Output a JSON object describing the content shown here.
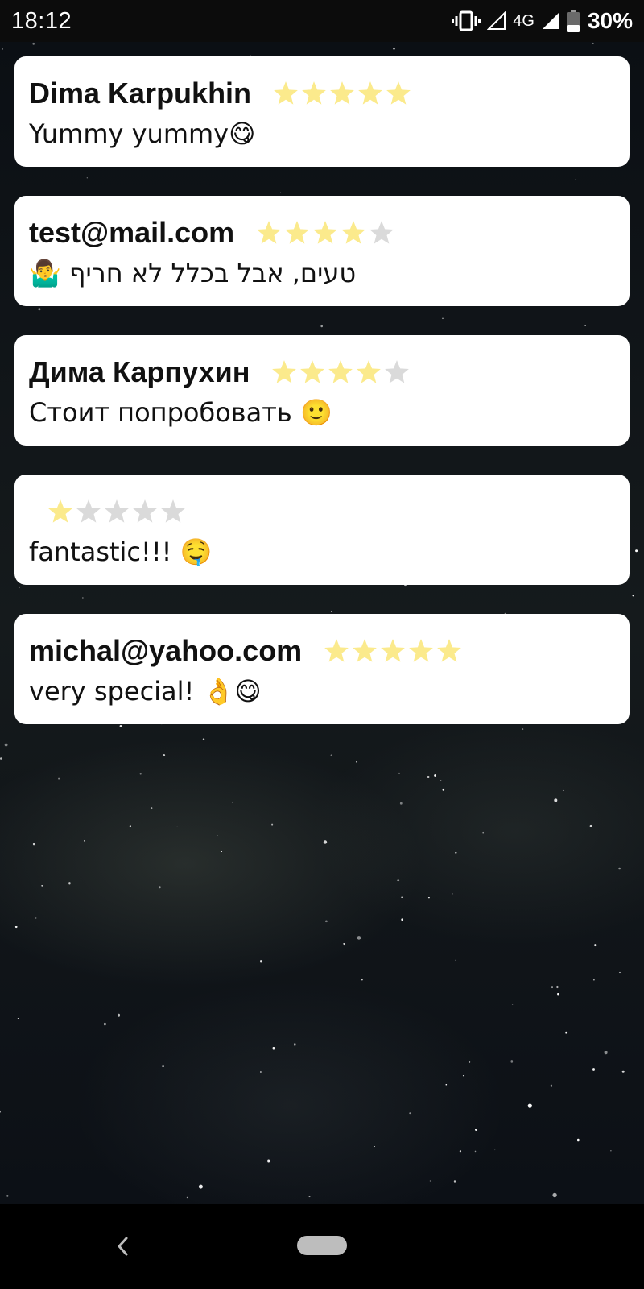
{
  "status_bar": {
    "time": "18:12",
    "network": "4G",
    "battery_percent": "30%",
    "icons": [
      "vibrate-icon",
      "signal-icon",
      "signal-full-icon",
      "battery-icon"
    ]
  },
  "reviews": [
    {
      "name": "Dima Karpukhin",
      "rating": 5,
      "max_rating": 5,
      "text": "Yummy yummy😋"
    },
    {
      "name": "test@mail.com",
      "rating": 4,
      "max_rating": 5,
      "text": "טעים, אבל בכלל לא חריף 🤷‍♂️"
    },
    {
      "name": "Дима Карпухин",
      "rating": 4,
      "max_rating": 5,
      "text": "Стоит попробовать 🙂"
    },
    {
      "name": "",
      "rating": 1,
      "max_rating": 5,
      "text": "fantastic!!! 🤤"
    },
    {
      "name": "michal@yahoo.com",
      "rating": 5,
      "max_rating": 5,
      "text": "very special! 👌😋"
    }
  ],
  "colors": {
    "star_filled": "#FBEA8C",
    "star_empty": "#DADADA",
    "card_background": "#FFFFFF",
    "text": "#111111"
  },
  "nav_bar": {
    "back_icon": "back-chevron-icon",
    "home_icon": "home-pill-icon"
  }
}
